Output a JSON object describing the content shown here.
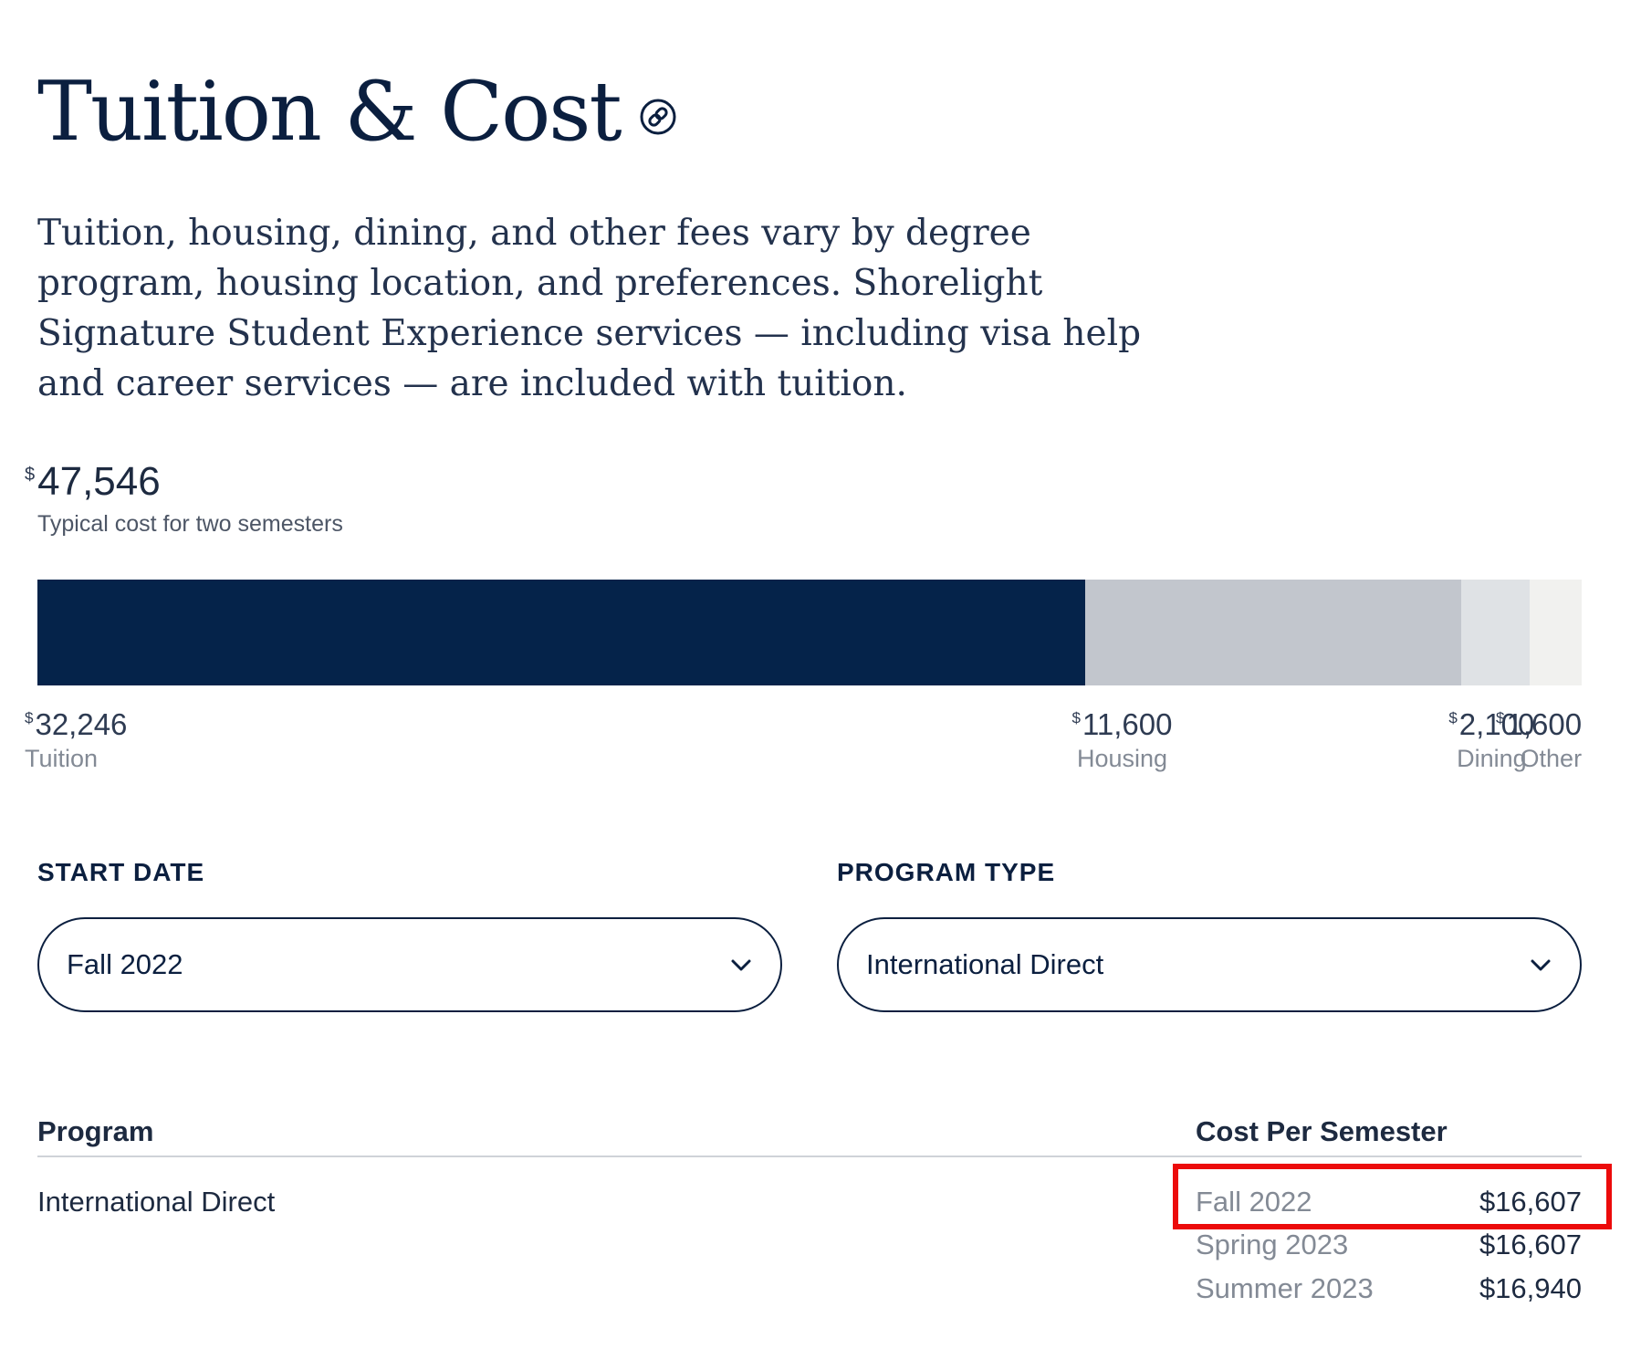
{
  "header": {
    "title": "Tuition & Cost",
    "intro": "Tuition, housing, dining, and other fees vary by degree program, housing location, and preferences. Shorelight Signature Student Experience services — including visa help and career services — are included with tuition."
  },
  "total": {
    "currency": "$",
    "value": "47,546",
    "caption": "Typical cost for two semesters"
  },
  "cost_breakdown": {
    "currency": "$",
    "items": [
      {
        "name": "Tuition",
        "amount": "32,246",
        "value": 32246,
        "color": "#05234a"
      },
      {
        "name": "Housing",
        "amount": "11,600",
        "value": 11600,
        "color": "#c2c6cd"
      },
      {
        "name": "Dining",
        "amount": "2,100",
        "value": 2100,
        "color": "#dfe2e5"
      },
      {
        "name": "Other",
        "amount": "1,600",
        "value": 1600,
        "color": "#f1f1ef"
      }
    ]
  },
  "filters": {
    "start_date": {
      "label": "START DATE",
      "value": "Fall 2022"
    },
    "program_type": {
      "label": "PROGRAM TYPE",
      "value": "International Direct"
    }
  },
  "table": {
    "headers": {
      "program": "Program",
      "cost": "Cost Per Semester"
    },
    "program": "International Direct",
    "rows": [
      {
        "term": "Fall 2022",
        "price": "$16,607"
      },
      {
        "term": "Spring 2023",
        "price": "$16,607"
      },
      {
        "term": "Summer 2023",
        "price": "$16,940"
      }
    ]
  },
  "colors": {
    "navy": "#0b1f3f",
    "highlight": "#ec0b0b"
  },
  "icons": {
    "title_link": "link-icon",
    "dropdown": "chevron-down-icon"
  }
}
